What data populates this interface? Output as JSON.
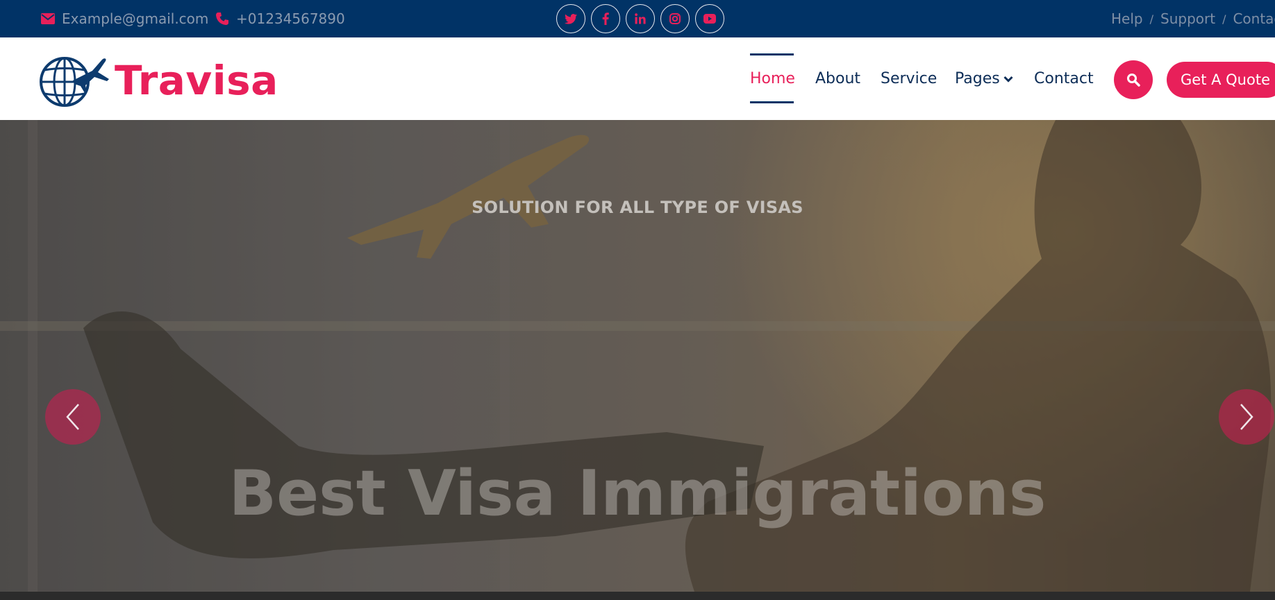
{
  "topbar": {
    "email": "Example@gmail.com",
    "phone": "+01234567890",
    "socials": [
      "twitter-icon",
      "facebook-icon",
      "linkedin-icon",
      "instagram-icon",
      "youtube-icon"
    ],
    "links": [
      "Help",
      "Support",
      "Contact"
    ]
  },
  "brand": {
    "name": "Travisa"
  },
  "nav": {
    "items": [
      "Home",
      "About",
      "Service",
      "Pages",
      "Contact"
    ],
    "active": "Home",
    "quote_label": "Get A Quote"
  },
  "hero": {
    "subtitle": "SOLUTION FOR ALL TYPE OF VISAS",
    "title": "Best Visa Immigrations"
  },
  "colors": {
    "accent": "#e8205a",
    "navy": "#013366"
  }
}
